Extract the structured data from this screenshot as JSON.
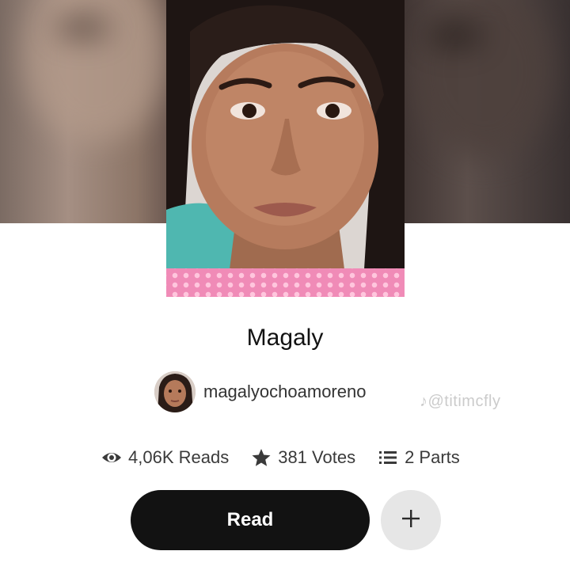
{
  "story": {
    "title": "Magaly",
    "author": "magalyochoamoreno"
  },
  "watermark": {
    "text": "@titimcfly",
    "icon": "tiktok-icon"
  },
  "stats": {
    "reads": {
      "icon": "eye-icon",
      "label": "4,06K Reads"
    },
    "votes": {
      "icon": "star-icon",
      "label": "381 Votes"
    },
    "parts": {
      "icon": "list-icon",
      "label": "2 Parts"
    }
  },
  "actions": {
    "read_label": "Read",
    "add_icon": "plus-icon"
  },
  "colors": {
    "button_dark": "#121212",
    "button_light": "#e6e6e6",
    "cover_strip": "#f08bb7",
    "text_primary": "#121212",
    "text_secondary": "#3a3a3a"
  }
}
